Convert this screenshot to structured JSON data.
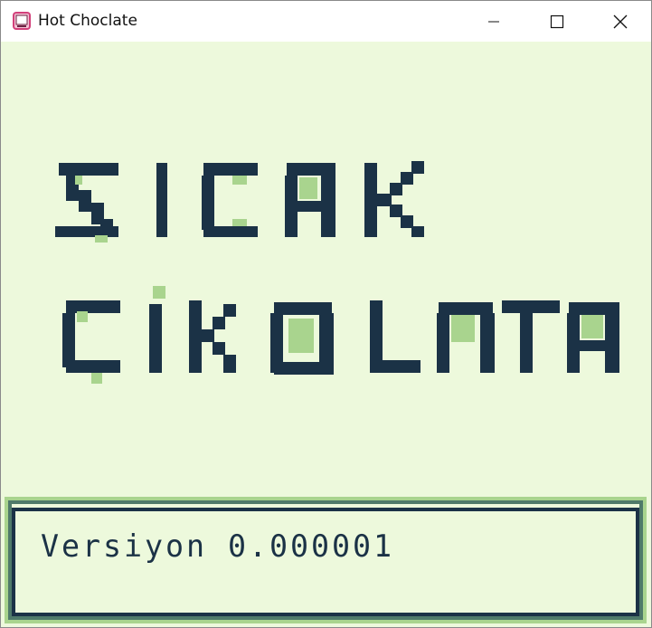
{
  "window": {
    "title": "Hot Choclate",
    "app_icon": "gameboy-app-icon",
    "controls": {
      "minimize": "minimize-icon",
      "maximize": "maximize-icon",
      "close": "close-icon"
    }
  },
  "screen": {
    "logo_line1": "SICAK",
    "logo_line2": "ÇİKOLATA",
    "version_label": "Versiyon 0.000001"
  },
  "colors": {
    "background": "#edf9dc",
    "dark": "#1b3246",
    "accent_green": "#a9d48e",
    "frame_mid": "#4f7a6a"
  }
}
